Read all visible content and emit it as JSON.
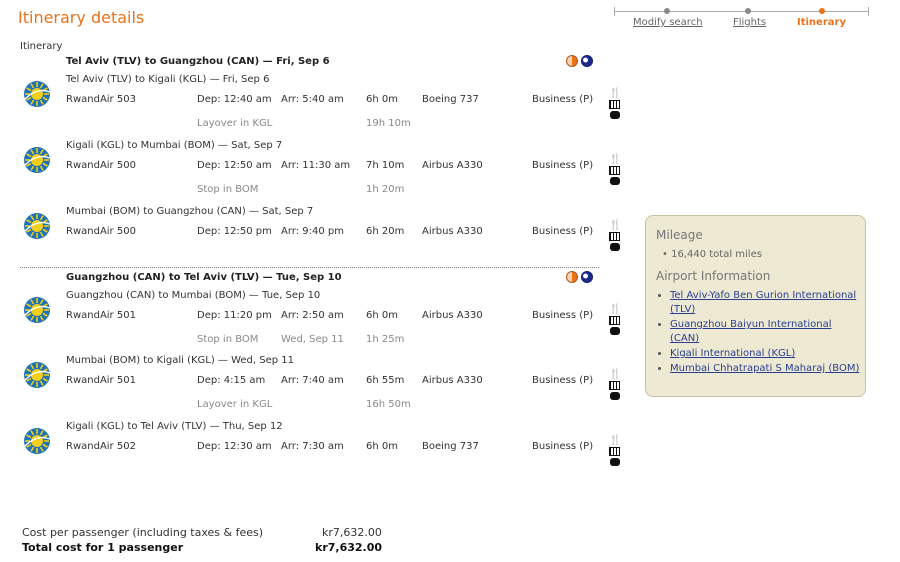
{
  "header": {
    "title": "Itinerary details",
    "section_label": "Itinerary"
  },
  "progress": {
    "steps": [
      {
        "label": "Modify search",
        "state": "link"
      },
      {
        "label": "Flights",
        "state": "link"
      },
      {
        "label": "Itinerary",
        "state": "active"
      }
    ],
    "active_color": "#e8731c"
  },
  "journeys": [
    {
      "title": "Tel Aviv (TLV) to Guangzhou (CAN) — Fri, Sep 6",
      "icons": [
        "day-icon",
        "night-icon"
      ],
      "segments": [
        {
          "route": "Tel Aviv (TLV) to Kigali (KGL) — Fri, Sep 6",
          "flight": "RwandAir 503",
          "dep": "Dep: 12:40 am",
          "arr": "Arr: 5:40 am",
          "duration": "6h 0m",
          "aircraft": "Boeing 737",
          "cabin": "Business (P)",
          "after": {
            "label": "Layover in KGL",
            "date": "",
            "time": "19h 10m"
          }
        },
        {
          "route": "Kigali (KGL) to Mumbai (BOM) — Sat, Sep 7",
          "flight": "RwandAir 500",
          "dep": "Dep: 12:50 am",
          "arr": "Arr: 11:30 am",
          "duration": "7h 10m",
          "aircraft": "Airbus A330",
          "cabin": "Business (P)",
          "after": {
            "label": "Stop in BOM",
            "date": "",
            "time": "1h 20m"
          }
        },
        {
          "route": "Mumbai (BOM) to Guangzhou (CAN) — Sat, Sep 7",
          "flight": "RwandAir 500",
          "dep": "Dep: 12:50 pm",
          "arr": "Arr: 9:40 pm",
          "duration": "6h 20m",
          "aircraft": "Airbus A330",
          "cabin": "Business (P)"
        }
      ]
    },
    {
      "title": "Guangzhou (CAN) to Tel Aviv (TLV) — Tue, Sep 10",
      "icons": [
        "day-icon",
        "night-icon"
      ],
      "segments": [
        {
          "route": "Guangzhou (CAN) to Mumbai (BOM) — Tue, Sep 10",
          "flight": "RwandAir 501",
          "dep": "Dep: 11:20 pm",
          "arr": "Arr: 2:50 am",
          "duration": "6h 0m",
          "aircraft": "Airbus A330",
          "cabin": "Business (P)",
          "after": {
            "label": "Stop in BOM",
            "date": "Wed, Sep 11",
            "time": "1h 25m"
          }
        },
        {
          "route": "Mumbai (BOM) to Kigali (KGL) — Wed, Sep 11",
          "flight": "RwandAir 501",
          "dep": "Dep: 4:15 am",
          "arr": "Arr: 7:40 am",
          "duration": "6h 55m",
          "aircraft": "Airbus A330",
          "cabin": "Business (P)",
          "after": {
            "label": "Layover in KGL",
            "date": "",
            "time": "16h 50m"
          }
        },
        {
          "route": "Kigali (KGL) to Tel Aviv (TLV) — Thu, Sep 12",
          "flight": "RwandAir 502",
          "dep": "Dep: 12:30 am",
          "arr": "Arr: 7:30 am",
          "duration": "6h 0m",
          "aircraft": "Boeing 737",
          "cabin": "Business (P)"
        }
      ]
    }
  ],
  "amenities": [
    "meal-icon",
    "video-icon",
    "power-icon"
  ],
  "sidebar": {
    "mileage_heading": "Mileage",
    "mileage_value": "16,440 total miles",
    "airport_heading": "Airport Information",
    "airports": [
      "Tel Aviv-Yafo Ben Gurion International (TLV)",
      "Guangzhou Baiyun International (CAN)",
      "Kigali International (KGL)",
      "Mumbai Chhatrapati S Maharaj (BOM)"
    ]
  },
  "totals": {
    "per_passenger_label": "Cost per passenger (including taxes & fees)",
    "per_passenger_value": "kr7,632.00",
    "total_label": "Total cost for 1 passenger",
    "total_value": "kr7,632.00"
  },
  "colors": {
    "accent": "#e8731c",
    "link": "#2a3f8f",
    "sidebar_bg": "#ede9d3",
    "logo_blue": "#1d72b8",
    "logo_yellow": "#f2cf1b"
  }
}
